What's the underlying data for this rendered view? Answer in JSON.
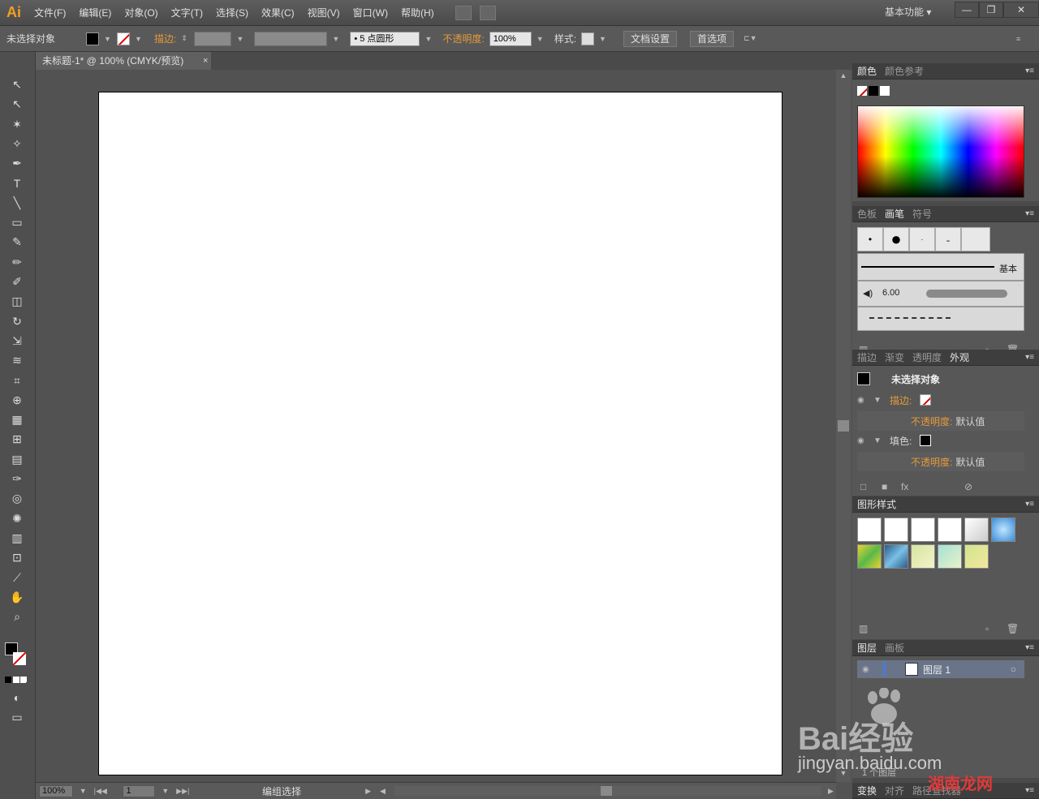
{
  "app": {
    "logo": "Ai",
    "workspace": "基本功能 ▾"
  },
  "menu": [
    "文件(F)",
    "编辑(E)",
    "对象(O)",
    "文字(T)",
    "选择(S)",
    "效果(C)",
    "视图(V)",
    "窗口(W)",
    "帮助(H)"
  ],
  "window_controls": [
    "—",
    "❐",
    "✕"
  ],
  "control_bar": {
    "selection": "未选择对象",
    "stroke_label": "描边:",
    "brush": "• 5 点圆形",
    "opacity_label": "不透明度:",
    "opacity_value": "100%",
    "style_label": "样式:",
    "doc_setup": "文档设置",
    "preferences": "首选项"
  },
  "document_tab": {
    "title": "未标题-1* @ 100% (CMYK/预览)",
    "close": "×"
  },
  "status_bar": {
    "zoom": "100%",
    "artboard": "1",
    "tool_status": "编组选择"
  },
  "panels": {
    "color": {
      "tabs": [
        "颜色",
        "颜色参考"
      ]
    },
    "brushes": {
      "tabs": [
        "色板",
        "画笔",
        "符号"
      ],
      "basic": "基本",
      "size": "6.00"
    },
    "appearance": {
      "tabs": [
        "描边",
        "渐变",
        "透明度",
        "外观"
      ],
      "title": "未选择对象",
      "stroke_label": "描边:",
      "opacity_label": "不透明度:",
      "default_value": "默认值",
      "fill_label": "填色:",
      "opacity_label2": "不透明度:",
      "default_value2": "默认值"
    },
    "graphic_styles": {
      "tabs": [
        "图形样式"
      ]
    },
    "layers": {
      "tabs": [
        "图层",
        "画板"
      ],
      "layer_name": "图层 1",
      "footer": "1 个图层"
    },
    "bottom": {
      "tabs": [
        "变换",
        "对齐",
        "路径查找器"
      ]
    }
  },
  "watermark": {
    "brand": "Bai经验",
    "sub": "jingyan.baidu.com",
    "overlay": "湖南龙网"
  },
  "tools": [
    {
      "name": "selection-tool-icon",
      "glyph": "↖"
    },
    {
      "name": "direct-selection-tool-icon",
      "glyph": "↖"
    },
    {
      "name": "magic-wand-tool-icon",
      "glyph": "✶"
    },
    {
      "name": "lasso-tool-icon",
      "glyph": "✧"
    },
    {
      "name": "pen-tool-icon",
      "glyph": "✒"
    },
    {
      "name": "type-tool-icon",
      "glyph": "T"
    },
    {
      "name": "line-tool-icon",
      "glyph": "╲"
    },
    {
      "name": "rectangle-tool-icon",
      "glyph": "▭"
    },
    {
      "name": "paintbrush-tool-icon",
      "glyph": "✎"
    },
    {
      "name": "pencil-tool-icon",
      "glyph": "✏"
    },
    {
      "name": "blob-brush-tool-icon",
      "glyph": "✐"
    },
    {
      "name": "eraser-tool-icon",
      "glyph": "◫"
    },
    {
      "name": "rotate-tool-icon",
      "glyph": "↻"
    },
    {
      "name": "scale-tool-icon",
      "glyph": "⇲"
    },
    {
      "name": "warp-tool-icon",
      "glyph": "≋"
    },
    {
      "name": "free-transform-tool-icon",
      "glyph": "⌗"
    },
    {
      "name": "shape-builder-tool-icon",
      "glyph": "⊕"
    },
    {
      "name": "perspective-grid-tool-icon",
      "glyph": "▦"
    },
    {
      "name": "mesh-tool-icon",
      "glyph": "⊞"
    },
    {
      "name": "gradient-tool-icon",
      "glyph": "▤"
    },
    {
      "name": "eyedropper-tool-icon",
      "glyph": "✑"
    },
    {
      "name": "blend-tool-icon",
      "glyph": "◎"
    },
    {
      "name": "symbol-sprayer-tool-icon",
      "glyph": "✺"
    },
    {
      "name": "column-graph-tool-icon",
      "glyph": "▥"
    },
    {
      "name": "artboard-tool-icon",
      "glyph": "⊡"
    },
    {
      "name": "slice-tool-icon",
      "glyph": "⟋"
    },
    {
      "name": "hand-tool-icon",
      "glyph": "✋"
    },
    {
      "name": "zoom-tool-icon",
      "glyph": "⌕"
    }
  ]
}
